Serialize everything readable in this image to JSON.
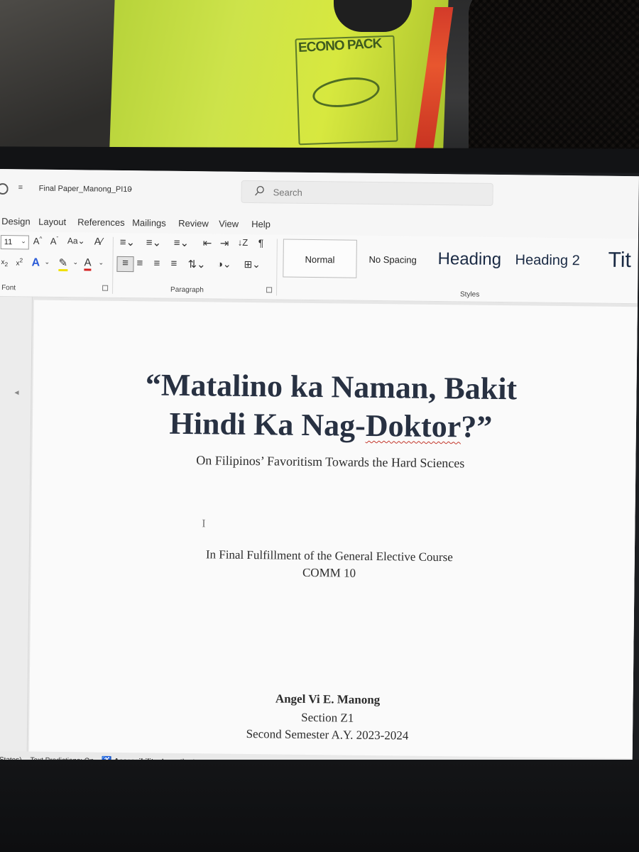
{
  "window": {
    "doc_title": "Final Paper_Manong_PI10",
    "search_placeholder": "Search"
  },
  "tabs": [
    "Design",
    "Layout",
    "References",
    "Mailings",
    "Review",
    "View",
    "Help"
  ],
  "ribbon": {
    "font_size": "11",
    "font_group_label": "Font",
    "paragraph_group_label": "Paragraph",
    "styles_group_label": "Styles",
    "styles": [
      "Normal",
      "No Spacing",
      "Heading",
      "Heading 2",
      "Tit"
    ]
  },
  "document": {
    "title_line1": "“Matalino ka Naman, Bakit",
    "title_line2_a": "Hindi Ka Nag-",
    "title_line2_b": "Doktor",
    "title_line2_c": "?”",
    "subtitle": "On Filipinos’ Favoritism Towards the Hard Sciences",
    "fulfillment": "In Final Fulfillment of the General Elective Course",
    "course": "COMM 10",
    "author": "Angel Vi E. Manong",
    "section": "Section Z1",
    "semester": "Second Semester A.Y. 2023-2024"
  },
  "statusbar": {
    "language": "d States)",
    "text_predictions": "Text Predictions: On",
    "accessibility": "Accessibility: Investigate"
  },
  "scene": {
    "bag_logo": "ECONO PACK"
  }
}
